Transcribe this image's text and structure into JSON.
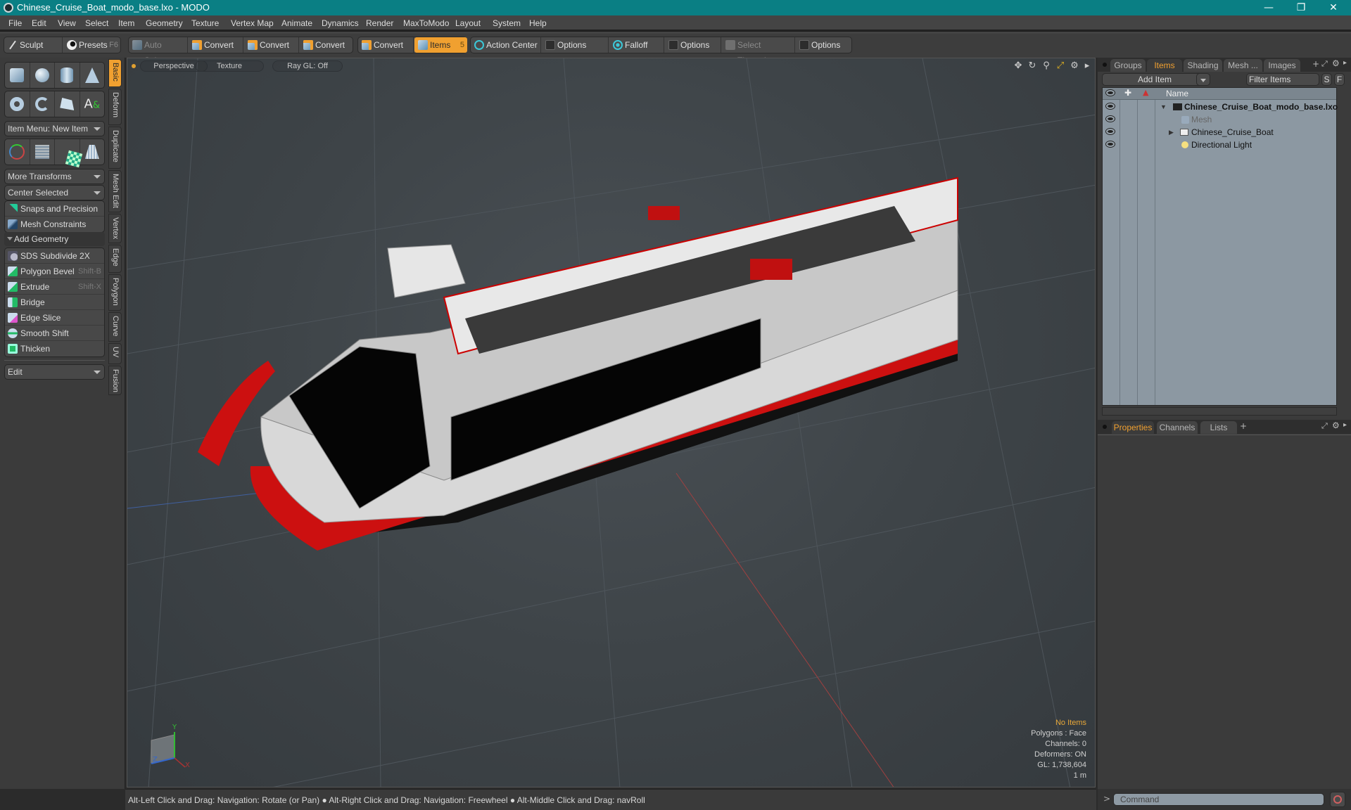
{
  "window": {
    "title": "Chinese_Cruise_Boat_modo_base.lxo - MODO",
    "controls": [
      "minimize",
      "maximize",
      "close"
    ]
  },
  "menu": [
    "File",
    "Edit",
    "View",
    "Select",
    "Item",
    "Geometry",
    "Texture",
    "Vertex Map",
    "Animate",
    "Dynamics",
    "Render",
    "MaxToModo",
    "Layout",
    "System",
    "Help"
  ],
  "toolbar": {
    "sculpt": "Sculpt",
    "presets": "Presets",
    "presets_shortcut": "F6",
    "auto_select": "Auto Select",
    "convert1": "Convert",
    "convert2": "Convert",
    "convert3": "Convert",
    "convert4": "Convert",
    "items": "Items",
    "items_badge": "5",
    "action_center": "Action Center",
    "options1": "Options",
    "falloff": "Falloff",
    "options2": "Options",
    "select_through": "Select Through",
    "options3": "Options"
  },
  "left_panel": {
    "item_menu": "Item Menu: New Item",
    "more_transforms": "More Transforms",
    "center_selected": "Center Selected",
    "snaps": "Snaps and Precision",
    "mesh_constraints": "Mesh Constraints",
    "add_geometry": "Add Geometry",
    "tools": [
      {
        "label": "SDS Subdivide 2X",
        "shortcut": ""
      },
      {
        "label": "Polygon Bevel",
        "shortcut": "Shift-B"
      },
      {
        "label": "Extrude",
        "shortcut": "Shift-X"
      },
      {
        "label": "Bridge",
        "shortcut": ""
      },
      {
        "label": "Edge Slice",
        "shortcut": ""
      },
      {
        "label": "Smooth Shift",
        "shortcut": ""
      },
      {
        "label": "Thicken",
        "shortcut": ""
      }
    ],
    "edit_dropdown": "Edit",
    "vertical_tabs": [
      "Basic",
      "Deform",
      "Duplicate",
      "Mesh Edit",
      "Vertex",
      "Edge",
      "Polygon",
      "Curve",
      "UV",
      "Fusion"
    ],
    "active_vertical_tab": "Basic"
  },
  "viewport": {
    "view_mode": "Perspective",
    "shading": "Texture",
    "raygl": "Ray GL: Off",
    "stats": {
      "selection": "No Items",
      "polygons": "Polygons : Face",
      "channels": "Channels: 0",
      "deformers": "Deformers: ON",
      "gl": "GL: 1,738,604",
      "scale": "1 m"
    },
    "axis_labels": {
      "x": "X",
      "y": "Y",
      "z": "Z"
    }
  },
  "status_bar": "Alt-Left Click and Drag: Navigation: Rotate (or Pan) ● Alt-Right Click and Drag: Navigation: Freewheel ● Alt-Middle Click and Drag: navRoll",
  "right_panel": {
    "tabs": [
      "Groups",
      "Items",
      "Shading",
      "Mesh ...",
      "Images"
    ],
    "active_tab": "Items",
    "add_item": "Add Item",
    "filter_placeholder": "Filter Items",
    "s_btn": "S",
    "f_btn": "F",
    "column_name": "Name",
    "items": [
      {
        "name": "Chinese_Cruise_Boat_modo_base.lxo",
        "type": "scene",
        "bold": true
      },
      {
        "name": "Mesh",
        "type": "mesh",
        "dim": true
      },
      {
        "name": "Chinese_Cruise_Boat",
        "type": "group"
      },
      {
        "name": "Directional Light",
        "type": "light"
      }
    ],
    "bottom_tabs": [
      "Properties",
      "Channels",
      "Lists"
    ],
    "active_bottom_tab": "Properties",
    "command_placeholder": "Command"
  },
  "colors": {
    "titlebar": "#0a7f84",
    "accent": "#f0a030"
  }
}
